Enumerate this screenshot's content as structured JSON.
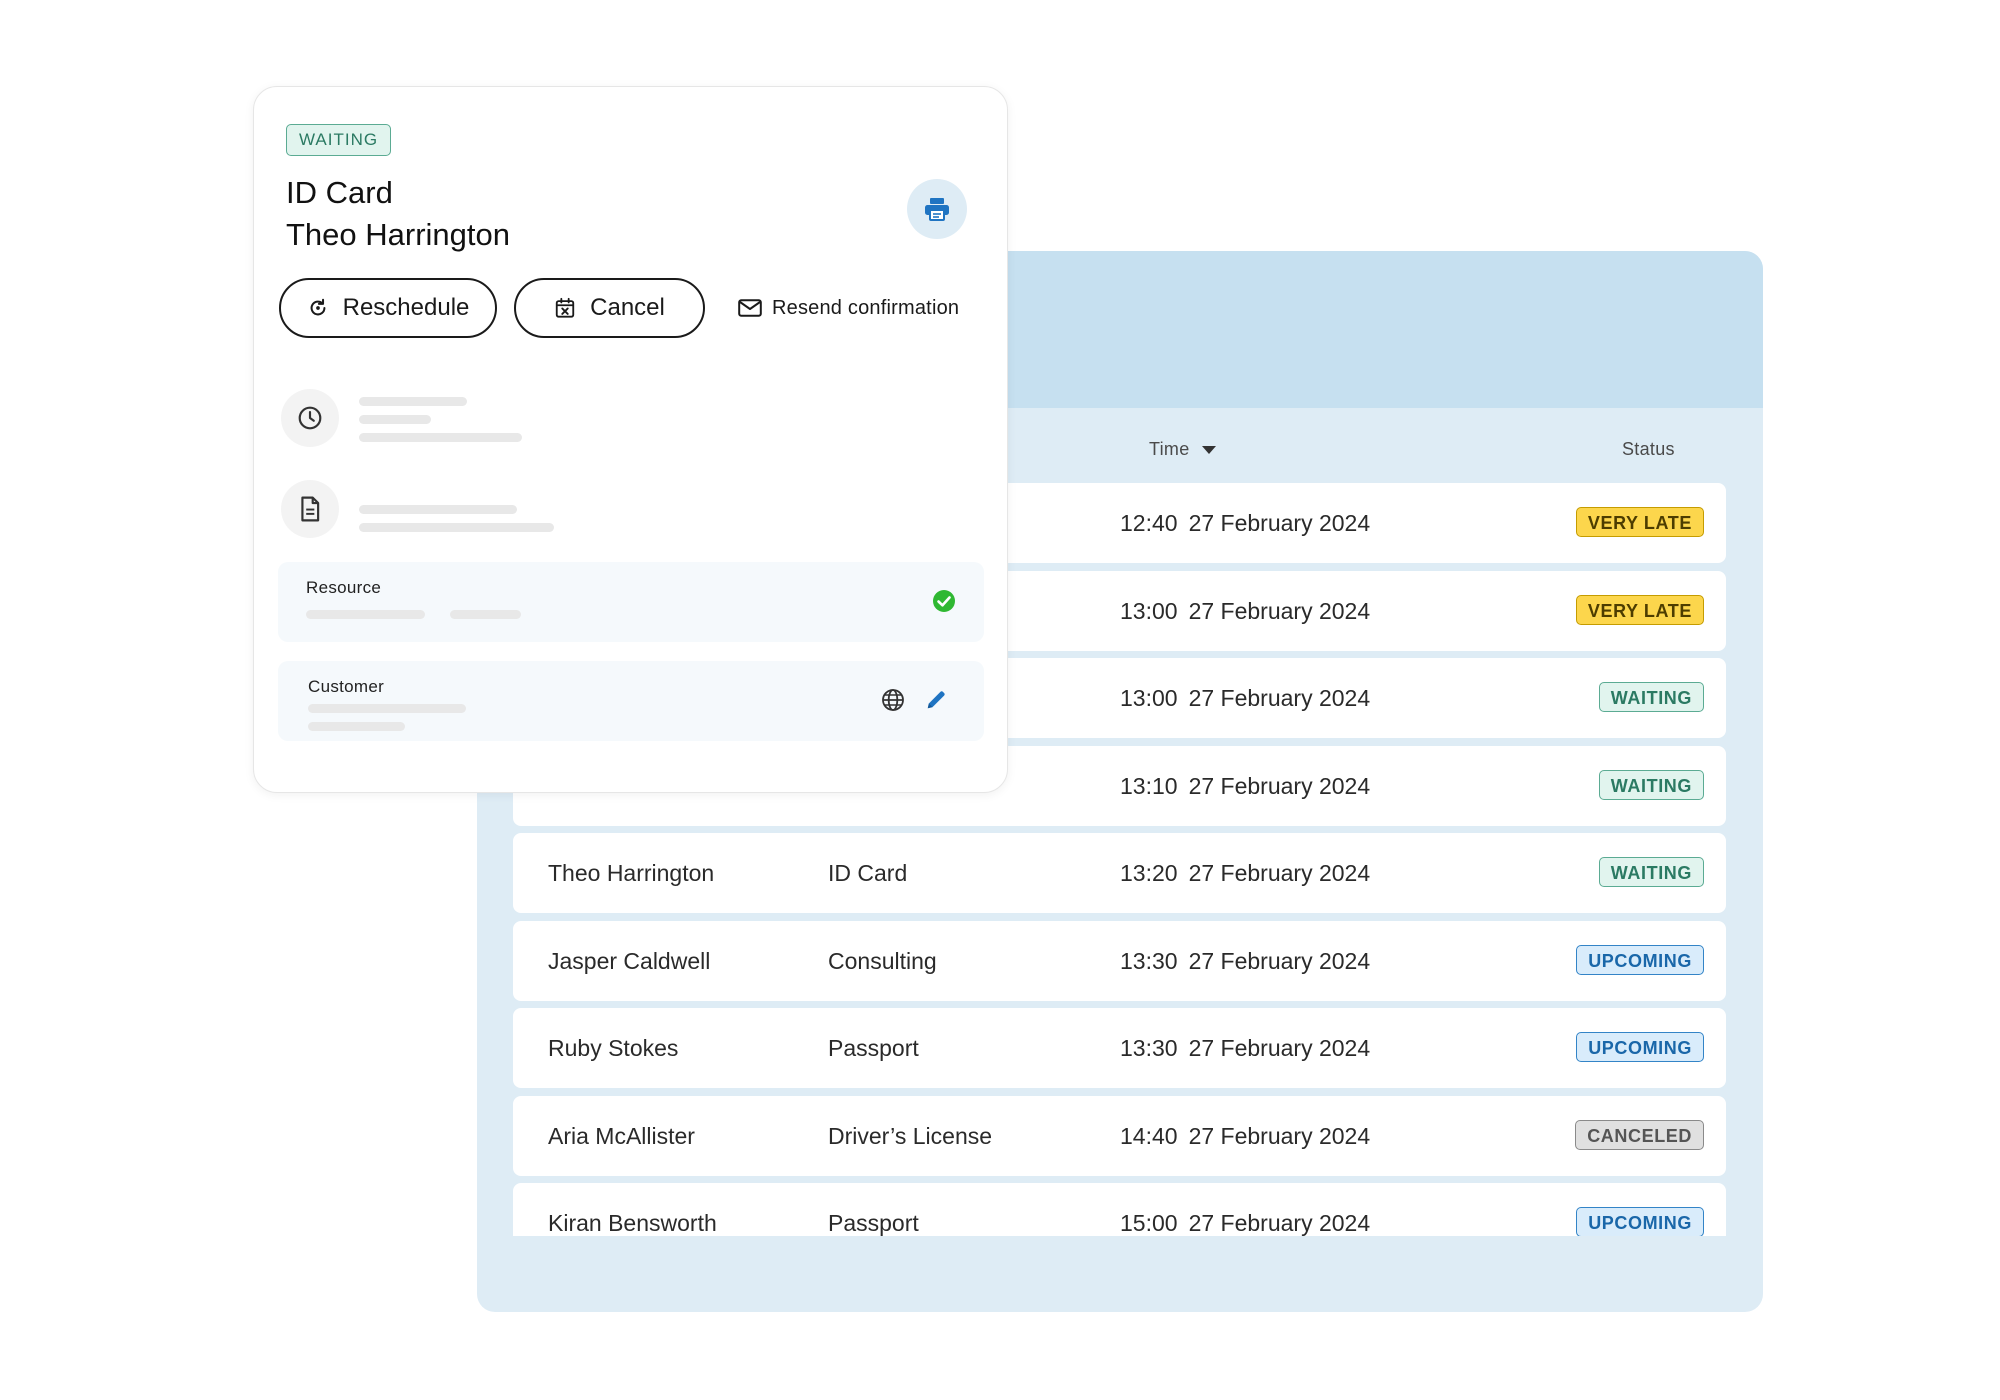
{
  "table": {
    "columns": {
      "time": "Time",
      "status": "Status"
    },
    "rows": [
      {
        "name": "",
        "service": "",
        "time": "12:40",
        "date": "27 February 2024",
        "status": "VERY LATE",
        "status_kind": "verylate"
      },
      {
        "name": "",
        "service": "",
        "time": "13:00",
        "date": "27 February 2024",
        "status": "VERY LATE",
        "status_kind": "verylate"
      },
      {
        "name": "",
        "service": "",
        "time": "13:00",
        "date": "27 February 2024",
        "status": "WAITING",
        "status_kind": "waiting"
      },
      {
        "name": "",
        "service": "",
        "time": "13:10",
        "date": "27 February 2024",
        "status": "WAITING",
        "status_kind": "waiting"
      },
      {
        "name": "Theo Harrington",
        "service": "ID Card",
        "time": "13:20",
        "date": "27 February 2024",
        "status": "WAITING",
        "status_kind": "waiting"
      },
      {
        "name": "Jasper Caldwell",
        "service": "Consulting",
        "time": "13:30",
        "date": "27 February 2024",
        "status": "UPCOMING",
        "status_kind": "upcoming"
      },
      {
        "name": "Ruby Stokes",
        "service": "Passport",
        "time": "13:30",
        "date": "27 February 2024",
        "status": "UPCOMING",
        "status_kind": "upcoming"
      },
      {
        "name": "Aria McAllister",
        "service": "Driver’s License",
        "time": "14:40",
        "date": "27 February 2024",
        "status": "CANCELED",
        "status_kind": "canceled"
      },
      {
        "name": "Kiran Bensworth",
        "service": "Passport",
        "time": "15:00",
        "date": "27 February 2024",
        "status": "UPCOMING",
        "status_kind": "upcoming"
      }
    ]
  },
  "card": {
    "status": "WAITING",
    "service": "ID Card",
    "customer_name": "Theo Harrington",
    "reschedule_label": "Reschedule",
    "cancel_label": "Cancel",
    "resend_label": "Resend confirmation",
    "resource_label": "Resource",
    "customer_label": "Customer"
  },
  "icons": {
    "print": "printer-icon",
    "reschedule": "refresh-icon",
    "cancel": "calendar-x-icon",
    "resend": "mail-icon",
    "time": "clock-icon",
    "document": "document-icon",
    "resource_status": "check-circle-icon",
    "language": "globe-icon",
    "edit": "pencil-icon"
  },
  "colors": {
    "panel_bg": "#deecf5",
    "panel_header": "#c6e0f0",
    "accent_blue": "#1f74c2",
    "success_green": "#2fb832"
  }
}
